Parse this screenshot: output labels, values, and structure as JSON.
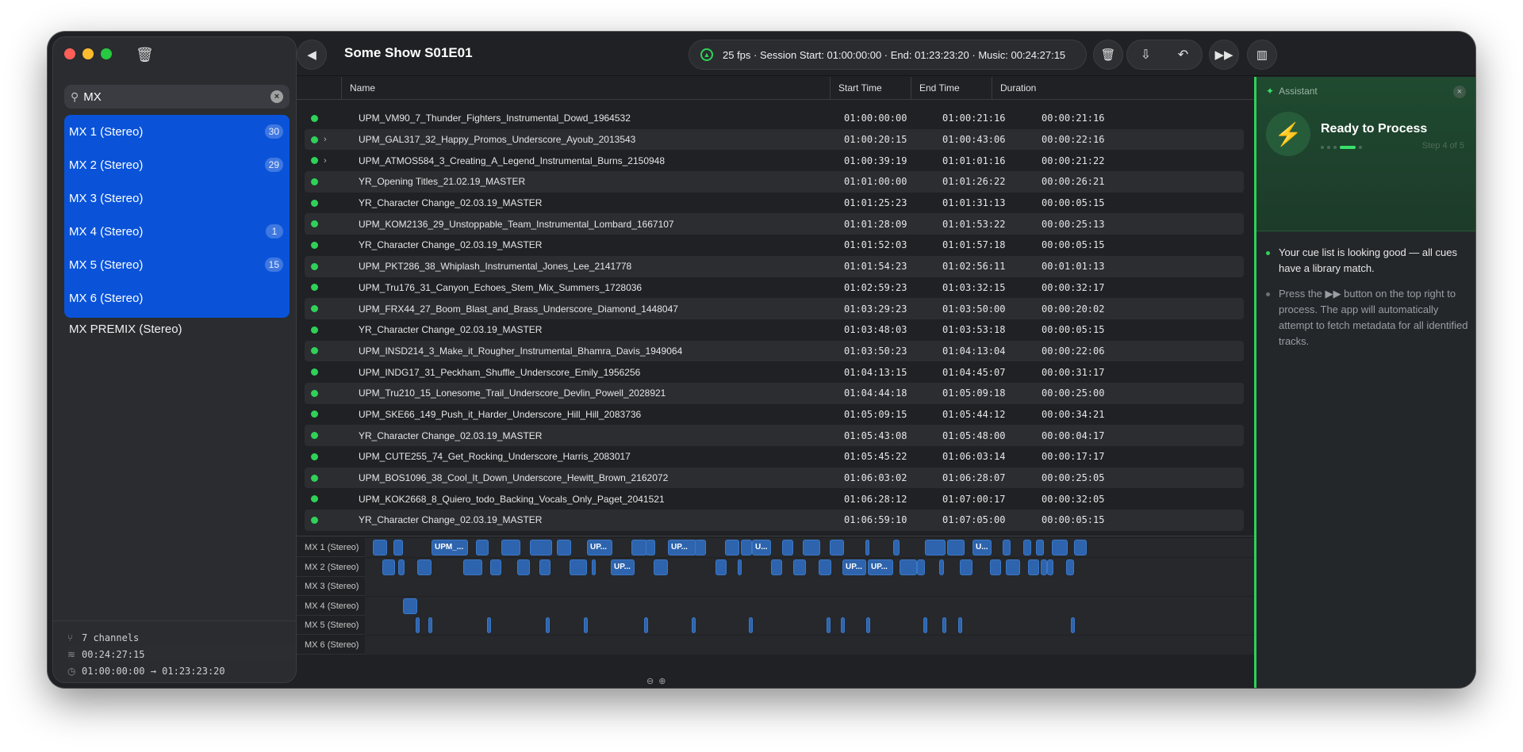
{
  "sidebar": {
    "search": {
      "value": "MX",
      "placeholder": ""
    },
    "channels": [
      {
        "label": "MX 1 (Stereo)",
        "count": "30"
      },
      {
        "label": "MX 2 (Stereo)",
        "count": "29"
      },
      {
        "label": "MX 3 (Stereo)",
        "count": ""
      },
      {
        "label": "MX 4 (Stereo)",
        "count": "1"
      },
      {
        "label": "MX 5 (Stereo)",
        "count": "15"
      },
      {
        "label": "MX 6 (Stereo)",
        "count": ""
      }
    ],
    "premix": "MX PREMIX (Stereo)",
    "footer": {
      "channels": "7 channels",
      "duration": "00:24:27:15",
      "range": "01:00:00:00 → 01:23:23:20"
    }
  },
  "toolbar": {
    "title": "Some Show S01E01",
    "status": "25 fps · Session Start: 01:00:00:00 · End: 01:23:23:20 · Music: 00:24:27:15"
  },
  "table": {
    "headers": [
      "Name",
      "Start Time",
      "End Time",
      "Duration"
    ],
    "rows": [
      [
        "UPM_VM90_7_Thunder_Fighters_Instrumental_Dowd_1964532",
        "01:00:00:00",
        "01:00:21:16",
        "00:00:21:16"
      ],
      [
        "UPM_GAL317_32_Happy_Promos_Underscore_Ayoub_2013543",
        "01:00:20:15",
        "01:00:43:06",
        "00:00:22:16"
      ],
      [
        "UPM_ATMOS584_3_Creating_A_Legend_Instrumental_Burns_2150948",
        "01:00:39:19",
        "01:01:01:16",
        "00:00:21:22"
      ],
      [
        "YR_Opening Titles_21.02.19_MASTER",
        "01:01:00:00",
        "01:01:26:22",
        "00:00:26:21"
      ],
      [
        "YR_Character Change_02.03.19_MASTER",
        "01:01:25:23",
        "01:01:31:13",
        "00:00:05:15"
      ],
      [
        "UPM_KOM2136_29_Unstoppable_Team_Instrumental_Lombard_1667107",
        "01:01:28:09",
        "01:01:53:22",
        "00:00:25:13"
      ],
      [
        "YR_Character Change_02.03.19_MASTER",
        "01:01:52:03",
        "01:01:57:18",
        "00:00:05:15"
      ],
      [
        "UPM_PKT286_38_Whiplash_Instrumental_Jones_Lee_2141778",
        "01:01:54:23",
        "01:02:56:11",
        "00:01:01:13"
      ],
      [
        "UPM_Tru176_31_Canyon_Echoes_Stem_Mix_Summers_1728036",
        "01:02:59:23",
        "01:03:32:15",
        "00:00:32:17"
      ],
      [
        "UPM_FRX44_27_Boom_Blast_and_Brass_Underscore_Diamond_1448047",
        "01:03:29:23",
        "01:03:50:00",
        "00:00:20:02"
      ],
      [
        "YR_Character Change_02.03.19_MASTER",
        "01:03:48:03",
        "01:03:53:18",
        "00:00:05:15"
      ],
      [
        "UPM_INSD214_3_Make_it_Rougher_Instrumental_Bhamra_Davis_1949064",
        "01:03:50:23",
        "01:04:13:04",
        "00:00:22:06"
      ],
      [
        "UPM_INDG17_31_Peckham_Shuffle_Underscore_Emily_1956256",
        "01:04:13:15",
        "01:04:45:07",
        "00:00:31:17"
      ],
      [
        "UPM_Tru210_15_Lonesome_Trail_Underscore_Devlin_Powell_2028921",
        "01:04:44:18",
        "01:05:09:18",
        "00:00:25:00"
      ],
      [
        "UPM_SKE66_149_Push_it_Harder_Underscore_Hill_Hill_2083736",
        "01:05:09:15",
        "01:05:44:12",
        "00:00:34:21"
      ],
      [
        "YR_Character Change_02.03.19_MASTER",
        "01:05:43:08",
        "01:05:48:00",
        "00:00:04:17"
      ],
      [
        "UPM_CUTE255_74_Get_Rocking_Underscore_Harris_2083017",
        "01:05:45:22",
        "01:06:03:14",
        "00:00:17:17"
      ],
      [
        "UPM_BOS1096_38_Cool_It_Down_Underscore_Hewitt_Brown_2162072",
        "01:06:03:02",
        "01:06:28:07",
        "00:00:25:05"
      ],
      [
        "UPM_KOK2668_8_Quiero_todo_Backing_Vocals_Only_Paget_2041521",
        "01:06:28:12",
        "01:07:00:17",
        "00:00:32:05"
      ],
      [
        "YR_Character Change_02.03.19_MASTER",
        "01:06:59:10",
        "01:07:05:00",
        "00:00:05:15"
      ]
    ]
  },
  "timeline": {
    "lanes": [
      "MX 1 (Stereo)",
      "MX 2 (Stereo)",
      "MX 3 (Stereo)",
      "MX 4 (Stereo)",
      "MX 5 (Stereo)",
      "MX 6 (Stereo)"
    ],
    "clip_label_full": "UPM_...",
    "clip_label_short": "UP...",
    "clip_label_u": "U..."
  },
  "assistant": {
    "header": "Assistant",
    "title": "Ready to Process",
    "step": "Step 4 of 5",
    "bullet_main": "Your cue list is looking good — all cues have a library match.",
    "bullet_sub": "Press the ▶▶ button on the top right to process. The app will automatically attempt to fetch metadata for all identified tracks."
  },
  "colors": {
    "accent": "#0a53d9",
    "ok": "#2fd158",
    "clip": "#2e64ad"
  }
}
